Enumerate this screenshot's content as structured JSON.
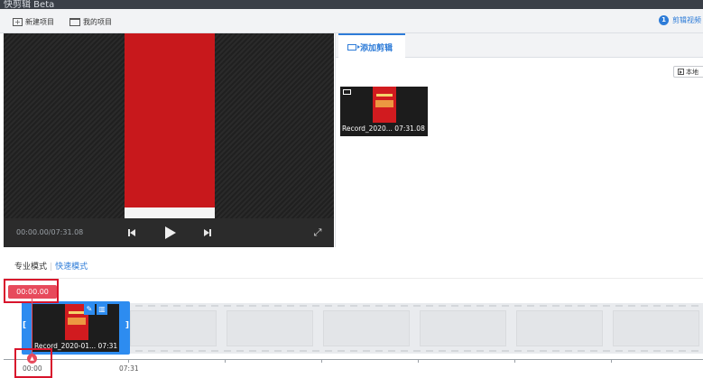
{
  "window": {
    "title": "快剪辑 Beta"
  },
  "toolbar": {
    "new_project": "新建项目",
    "my_projects": "我的项目",
    "help_number": "1",
    "help_label": "剪辑视频"
  },
  "player": {
    "time": "00:00.00/07:31.08"
  },
  "media": {
    "tab_label": "添加剪辑",
    "local_label": "本地",
    "clip": {
      "name": "Record_2020...",
      "duration": "07:31.08"
    }
  },
  "timeline": {
    "mode_pro": "专业模式",
    "mode_fast": "快速模式",
    "playhead_time": "00:00.00",
    "clip": {
      "name": "Record_2020-01...",
      "duration": "07:31"
    },
    "ruler": [
      "00:00",
      "07:31"
    ]
  },
  "colors": {
    "accent": "#2e7cd8",
    "playhead": "#e74a5c",
    "highlight": "#d8142c",
    "video_red": "#c8181c"
  }
}
